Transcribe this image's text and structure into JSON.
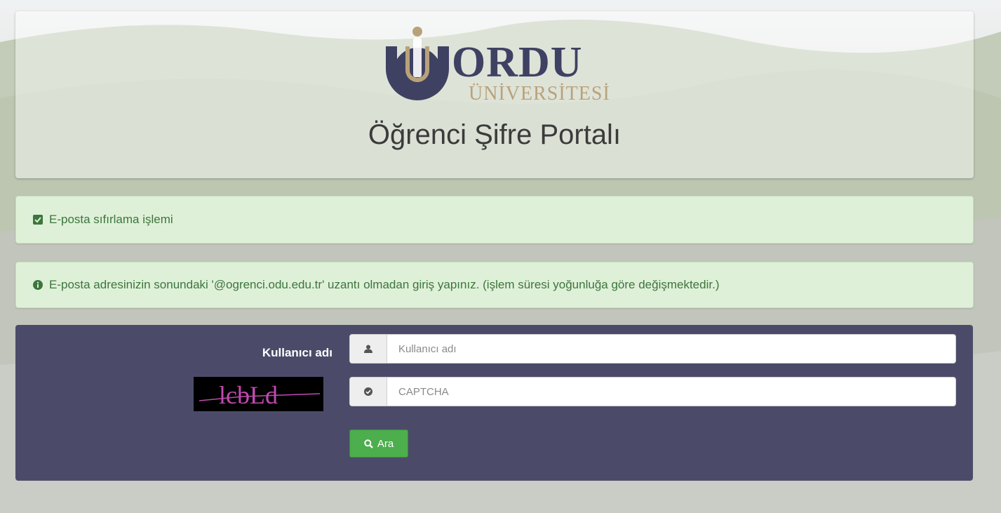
{
  "header": {
    "logo": {
      "name": "ORDU",
      "subtitle": "ÜNİVERSİTESİ"
    },
    "title": "Öğrenci Şifre Portalı"
  },
  "alerts": [
    {
      "icon": "check-square-icon",
      "text": "E-posta sıfırlama işlemi"
    },
    {
      "icon": "info-circle-icon",
      "text": "E-posta adresinizin sonundaki '@ogrenci.odu.edu.tr' uzantı olmadan giriş yapınız. (işlem süresi yoğunluğa göre değişmektedir.)"
    }
  ],
  "form": {
    "username_label": "Kullanıcı adı",
    "username_placeholder": "Kullanıcı adı",
    "username_value": "",
    "captcha_text": "lcbLd",
    "captcha_placeholder": "CAPTCHA",
    "captcha_value": "",
    "search_button": "Ara"
  },
  "colors": {
    "panel": "#4b4b69",
    "logo_navy": "#3f4163",
    "logo_gold": "#b9a27a",
    "alert_bg": "#dff0d8",
    "alert_text": "#3c763d",
    "button_green": "#4cae4c",
    "captcha_text": "#c04ab0"
  }
}
